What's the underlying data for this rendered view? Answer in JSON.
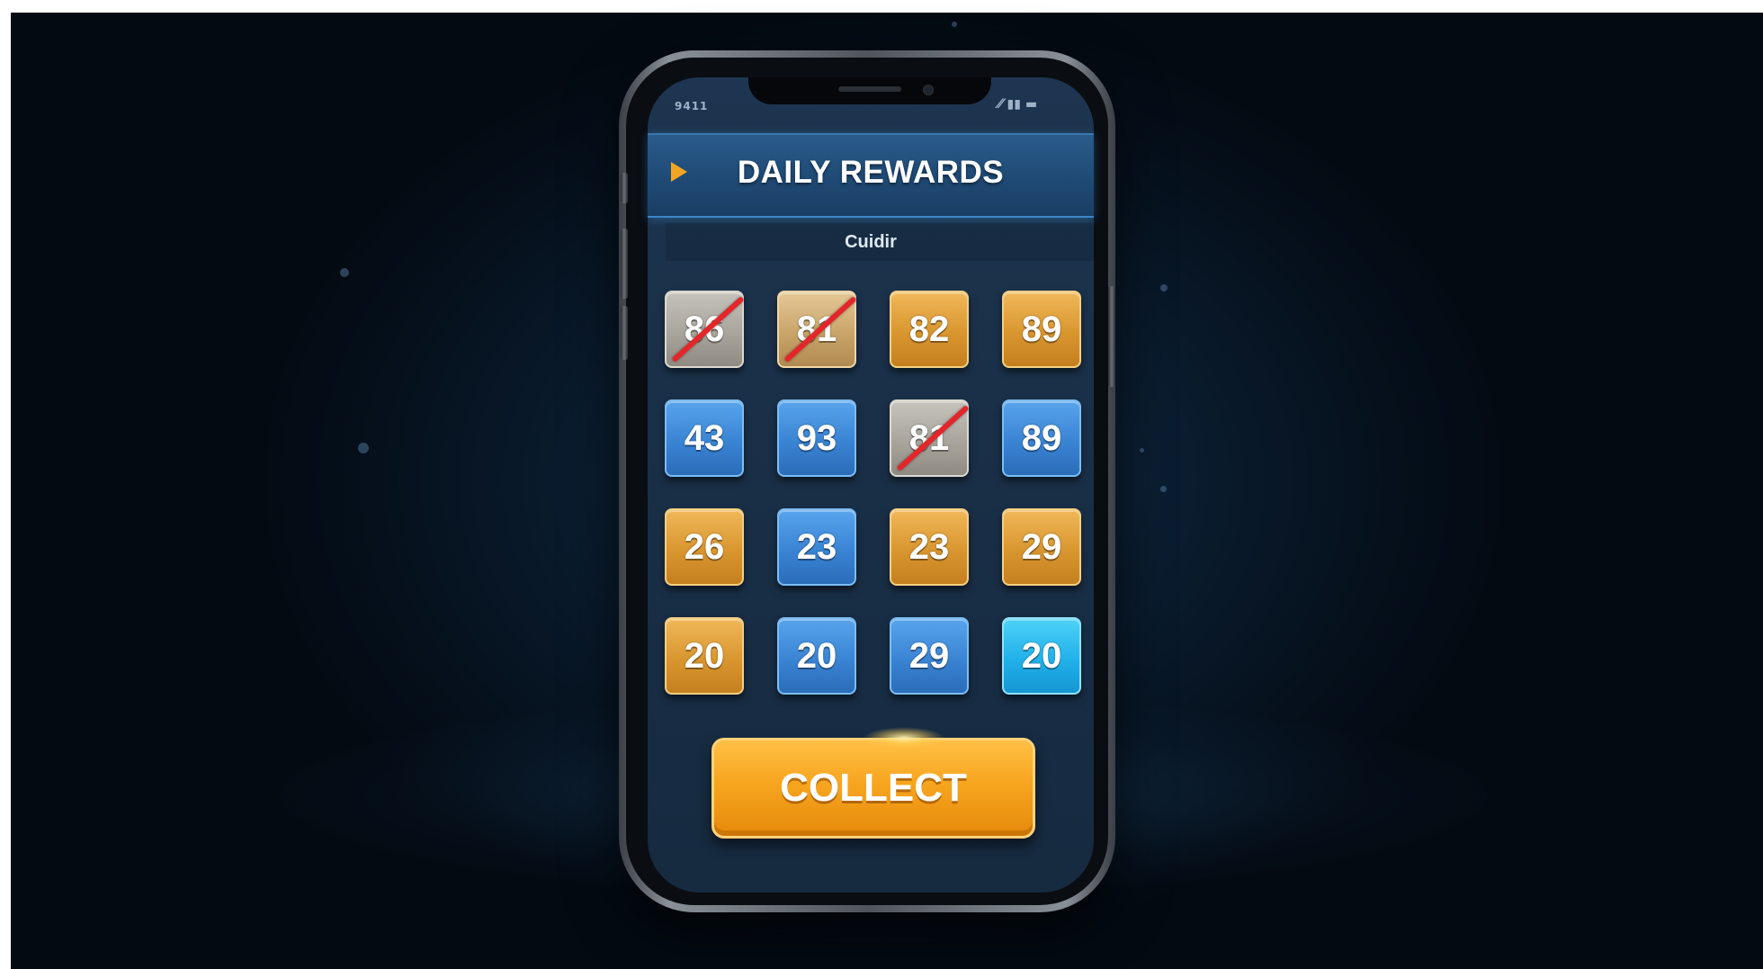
{
  "status_bar": {
    "time": "9411",
    "indicators": "⁄⁄ ▮▮ ▬"
  },
  "header": {
    "title": "DAILY REWARDS",
    "back_icon": "chevron-right-icon",
    "accent_color": "#f3a623"
  },
  "subheader": {
    "title": "Cuidir"
  },
  "grid": {
    "rows": [
      [
        {
          "value": "86",
          "style": "claimed-grey",
          "claimed": true
        },
        {
          "value": "81",
          "style": "claimed-gold",
          "claimed": true
        },
        {
          "value": "82",
          "style": "gold",
          "claimed": false
        },
        {
          "value": "89",
          "style": "gold",
          "claimed": false
        }
      ],
      [
        {
          "value": "43",
          "style": "blue",
          "claimed": false
        },
        {
          "value": "93",
          "style": "blue",
          "claimed": false
        },
        {
          "value": "81",
          "style": "claimed-grey",
          "claimed": true
        },
        {
          "value": "89",
          "style": "blue",
          "claimed": false
        }
      ],
      [
        {
          "value": "26",
          "style": "gold",
          "claimed": false
        },
        {
          "value": "23",
          "style": "blue",
          "claimed": false
        },
        {
          "value": "23",
          "style": "gold",
          "claimed": false
        },
        {
          "value": "29",
          "style": "gold",
          "claimed": false
        }
      ],
      [
        {
          "value": "20",
          "style": "gold",
          "claimed": false
        },
        {
          "value": "20",
          "style": "blue",
          "claimed": false
        },
        {
          "value": "29",
          "style": "blue",
          "claimed": false
        },
        {
          "value": "20",
          "style": "cyan",
          "claimed": false
        }
      ]
    ],
    "colors": {
      "gold": "#d9962f",
      "blue": "#3a84d4",
      "cyan": "#22b1ea",
      "claimed": "#a9a59c",
      "slash": "#e3262a"
    }
  },
  "collect_button": {
    "label": "COLLECT",
    "color": "#f7a51f"
  }
}
